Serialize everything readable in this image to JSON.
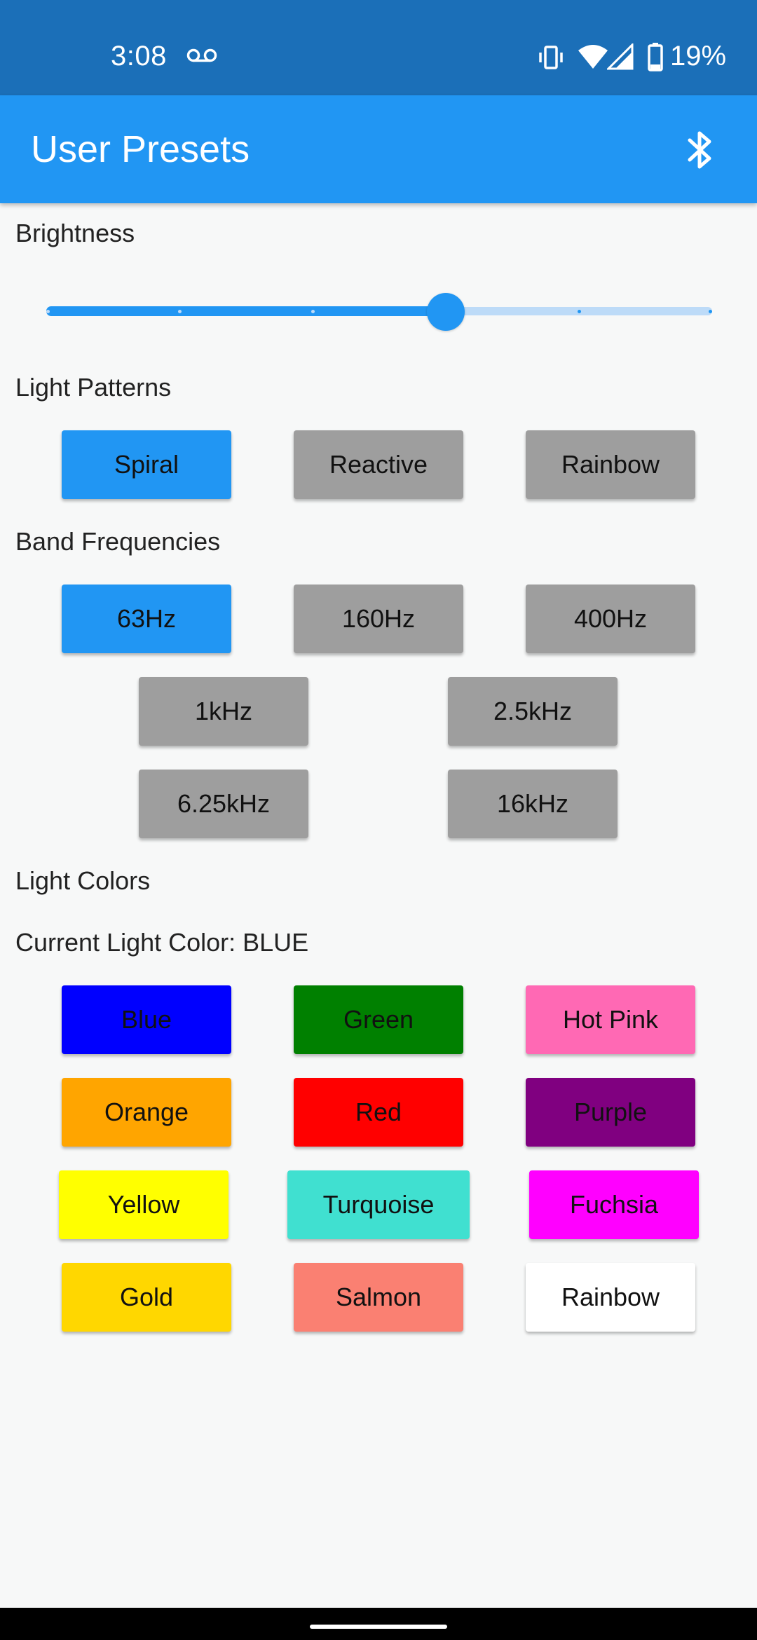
{
  "status_bar": {
    "time": "3:08",
    "battery": "19%",
    "icons": [
      "voicemail-icon",
      "vibrate-icon",
      "wifi-icon",
      "signal-icon",
      "battery-icon"
    ]
  },
  "app_bar": {
    "title": "User Presets",
    "action_icon": "bluetooth-icon"
  },
  "brightness": {
    "label": "Brightness",
    "value_fraction": 0.6,
    "divisions": 5
  },
  "light_patterns": {
    "label": "Light Patterns",
    "buttons": [
      "Spiral",
      "Reactive",
      "Rainbow"
    ],
    "selected": "Spiral"
  },
  "band_frequencies": {
    "label": "Band Frequencies",
    "buttons": [
      "63Hz",
      "160Hz",
      "400Hz",
      "1kHz",
      "2.5kHz",
      "6.25kHz",
      "16kHz"
    ],
    "selected": "63Hz"
  },
  "light_colors": {
    "label": "Light Colors",
    "current_label": "Current Light Color: BLUE",
    "buttons": [
      {
        "label": "Blue",
        "color": "#0000ff"
      },
      {
        "label": "Green",
        "color": "#008000"
      },
      {
        "label": "Hot Pink",
        "color": "#ff69b4"
      },
      {
        "label": "Orange",
        "color": "#ffa500"
      },
      {
        "label": "Red",
        "color": "#ff0000"
      },
      {
        "label": "Purple",
        "color": "#800080"
      },
      {
        "label": "Yellow",
        "color": "#ffff00"
      },
      {
        "label": "Turquoise",
        "color": "#40e0d0"
      },
      {
        "label": "Fuchsia",
        "color": "#ff00ff"
      },
      {
        "label": "Gold",
        "color": "#ffd700"
      },
      {
        "label": "Salmon",
        "color": "#fa8072"
      },
      {
        "label": "Rainbow",
        "color": "#ffffff"
      }
    ]
  },
  "colors": {
    "primary": "#2196f3",
    "status_bar": "#1b6fb8",
    "unselected_button": "#9e9e9e"
  }
}
